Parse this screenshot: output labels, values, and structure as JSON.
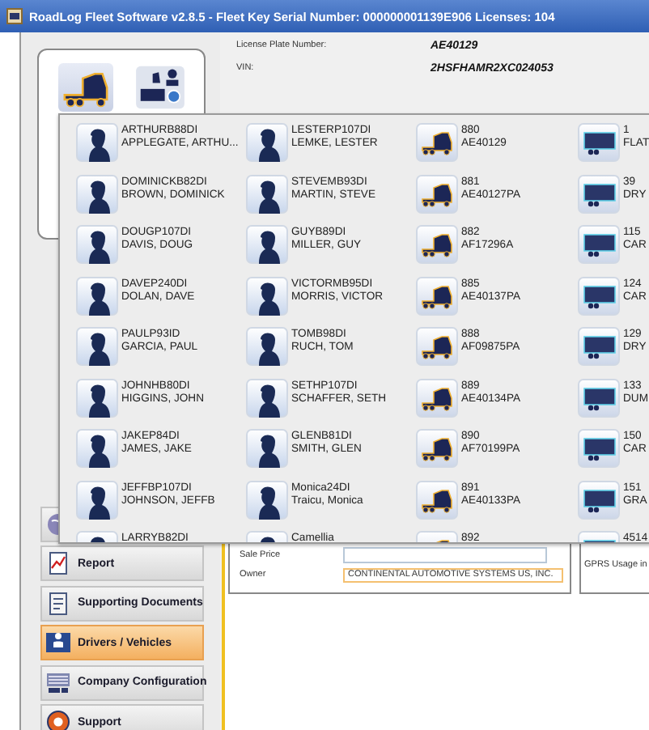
{
  "window": {
    "title": "RoadLog Fleet Software v2.8.5 - Fleet Key Serial Number: 000000001139E906 Licenses: 104"
  },
  "icon_tabs": [
    {
      "kind": "truck",
      "selected": true
    },
    {
      "kind": "fleet",
      "selected": false
    }
  ],
  "nav": [
    {
      "kind": "globe",
      "selected": false
    },
    {
      "kind": "report",
      "label": "Report",
      "selected": false
    },
    {
      "kind": "documents",
      "label": "Supporting Documents",
      "selected": false
    },
    {
      "kind": "drivers",
      "label": "Drivers / Vehicles",
      "selected": true
    },
    {
      "kind": "company",
      "label": "Company Configuration",
      "selected": false
    },
    {
      "kind": "support",
      "label": "Support",
      "selected": false
    }
  ],
  "details": {
    "license_plate_label": "License Plate Number:",
    "license_plate": "AE40129",
    "vin_label": "VIN:",
    "vin": "2HSFHAMR2XC024053"
  },
  "form": {
    "sale_price_label": "Sale Price",
    "owner_label": "Owner",
    "owner": "CONTINENTAL AUTOMOTIVE SYSTEMS US, INC.",
    "side_label": "GPRS Usage in"
  },
  "popup": {
    "items": [
      {
        "kind": "driver",
        "line1": "ARTHURB88DI",
        "line2": "APPLEGATE, ARTHU..."
      },
      {
        "kind": "driver",
        "line1": "LESTERP107DI",
        "line2": "LEMKE, LESTER"
      },
      {
        "kind": "truck",
        "line1": "880",
        "line2": "AE40129"
      },
      {
        "kind": "trailer",
        "line1": "1",
        "line2": "FLAT"
      },
      {
        "kind": "driver",
        "line1": "DOMINICKB82DI",
        "line2": "BROWN, DOMINICK"
      },
      {
        "kind": "driver",
        "line1": "STEVEMB93DI",
        "line2": "MARTIN, STEVE"
      },
      {
        "kind": "truck",
        "line1": "881",
        "line2": "AE40127PA"
      },
      {
        "kind": "trailer",
        "line1": "39",
        "line2": "DRY"
      },
      {
        "kind": "driver",
        "line1": "DOUGP107DI",
        "line2": "DAVIS, DOUG"
      },
      {
        "kind": "driver",
        "line1": "GUYB89DI",
        "line2": "MILLER, GUY"
      },
      {
        "kind": "truck",
        "line1": "882",
        "line2": "AF17296A"
      },
      {
        "kind": "trailer",
        "line1": "115",
        "line2": "CAR"
      },
      {
        "kind": "driver",
        "line1": "DAVEP240DI",
        "line2": "DOLAN, DAVE"
      },
      {
        "kind": "driver",
        "line1": "VICTORMB95DI",
        "line2": "MORRIS, VICTOR"
      },
      {
        "kind": "truck",
        "line1": "885",
        "line2": "AE40137PA"
      },
      {
        "kind": "trailer",
        "line1": "124",
        "line2": "CAR"
      },
      {
        "kind": "driver",
        "line1": "PAULP93ID",
        "line2": "GARCIA, PAUL"
      },
      {
        "kind": "driver",
        "line1": "TOMB98DI",
        "line2": "RUCH, TOM"
      },
      {
        "kind": "truck",
        "line1": "888",
        "line2": "AF09875PA"
      },
      {
        "kind": "trailer",
        "line1": "129",
        "line2": "DRY"
      },
      {
        "kind": "driver",
        "line1": "JOHNHB80DI",
        "line2": "HIGGINS, JOHN"
      },
      {
        "kind": "driver",
        "line1": "SETHP107DI",
        "line2": "SCHAFFER, SETH"
      },
      {
        "kind": "truck",
        "line1": "889",
        "line2": "AE40134PA"
      },
      {
        "kind": "trailer",
        "line1": "133",
        "line2": "DUM"
      },
      {
        "kind": "driver",
        "line1": "JAKEP84DI",
        "line2": "JAMES, JAKE"
      },
      {
        "kind": "driver",
        "line1": "GLENB81DI",
        "line2": "SMITH, GLEN"
      },
      {
        "kind": "truck",
        "line1": "890",
        "line2": "AF70199PA"
      },
      {
        "kind": "trailer",
        "line1": "150",
        "line2": "CAR"
      },
      {
        "kind": "driver",
        "line1": "JEFFBP107DI",
        "line2": "JOHNSON, JEFFB"
      },
      {
        "kind": "driver",
        "line1": "Monica24DI",
        "line2": "Traicu, Monica"
      },
      {
        "kind": "truck",
        "line1": "891",
        "line2": "AE40133PA"
      },
      {
        "kind": "trailer",
        "line1": "151",
        "line2": "GRA"
      },
      {
        "kind": "driver",
        "line1": "LARRYB82DI"
      },
      {
        "kind": "driver",
        "line1": "Camellia"
      },
      {
        "kind": "truck",
        "line1": "892"
      },
      {
        "kind": "trailer",
        "line1": "4514"
      }
    ]
  }
}
